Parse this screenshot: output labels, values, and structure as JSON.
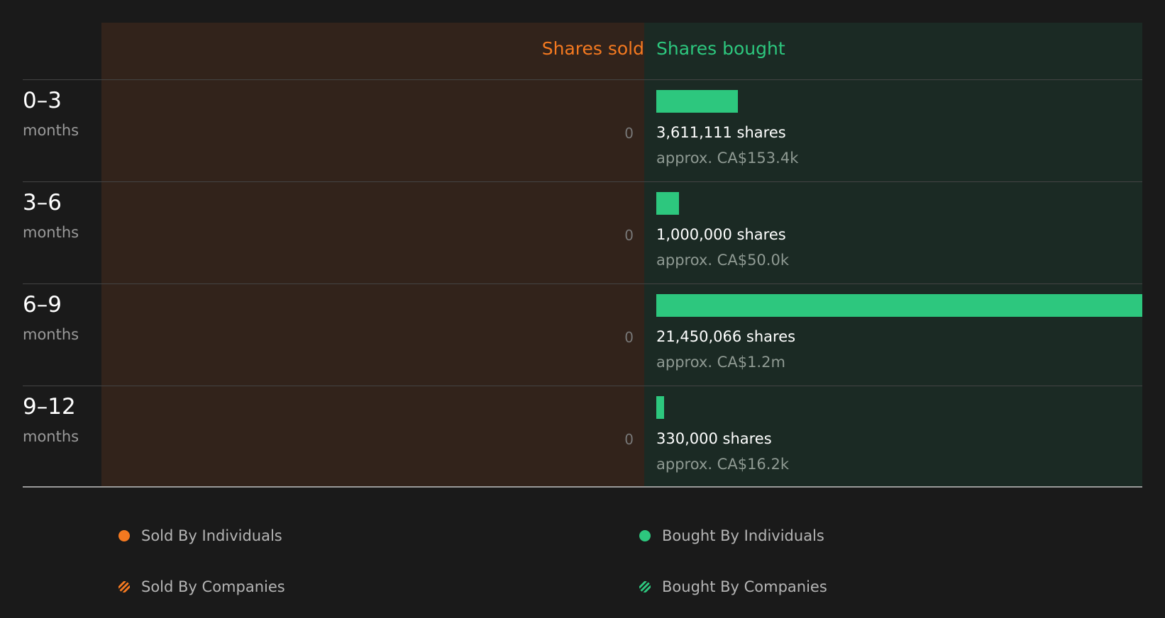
{
  "colors": {
    "sold": "#f47920",
    "bought": "#2dc77e",
    "sold_panel": "#32231b",
    "bought_panel": "#1b2a24"
  },
  "chart_data": {
    "type": "bar",
    "orientation": "horizontal-diverging",
    "headers": {
      "sold": "Shares sold",
      "bought": "Shares bought"
    },
    "categories": [
      {
        "range": "0–3",
        "unit": "months"
      },
      {
        "range": "3–6",
        "unit": "months"
      },
      {
        "range": "6–9",
        "unit": "months"
      },
      {
        "range": "9–12",
        "unit": "months"
      }
    ],
    "series": [
      {
        "name": "Sold By Individuals",
        "values": [
          0,
          0,
          0,
          0
        ],
        "labels": [
          "0",
          "0",
          "0",
          "0"
        ]
      },
      {
        "name": "Bought By Individuals",
        "values": [
          3611111,
          1000000,
          21450066,
          330000
        ],
        "labels": [
          "3,611,111 shares",
          "1,000,000 shares",
          "21,450,066 shares",
          "330,000 shares"
        ],
        "approx": [
          "approx. CA$153.4k",
          "approx. CA$50.0k",
          "approx. CA$1.2m",
          "approx. CA$16.2k"
        ]
      }
    ],
    "xlim": [
      0,
      21450066
    ]
  },
  "legend": [
    {
      "label": "Sold By Individuals",
      "icon": "solid-dot-icon",
      "color": "#f47920"
    },
    {
      "label": "Bought By Individuals",
      "icon": "solid-dot-icon",
      "color": "#2dc77e"
    },
    {
      "label": "Sold By Companies",
      "icon": "hatched-dot-icon",
      "color": "#f47920"
    },
    {
      "label": "Bought By Companies",
      "icon": "hatched-dot-icon",
      "color": "#2dc77e"
    }
  ]
}
